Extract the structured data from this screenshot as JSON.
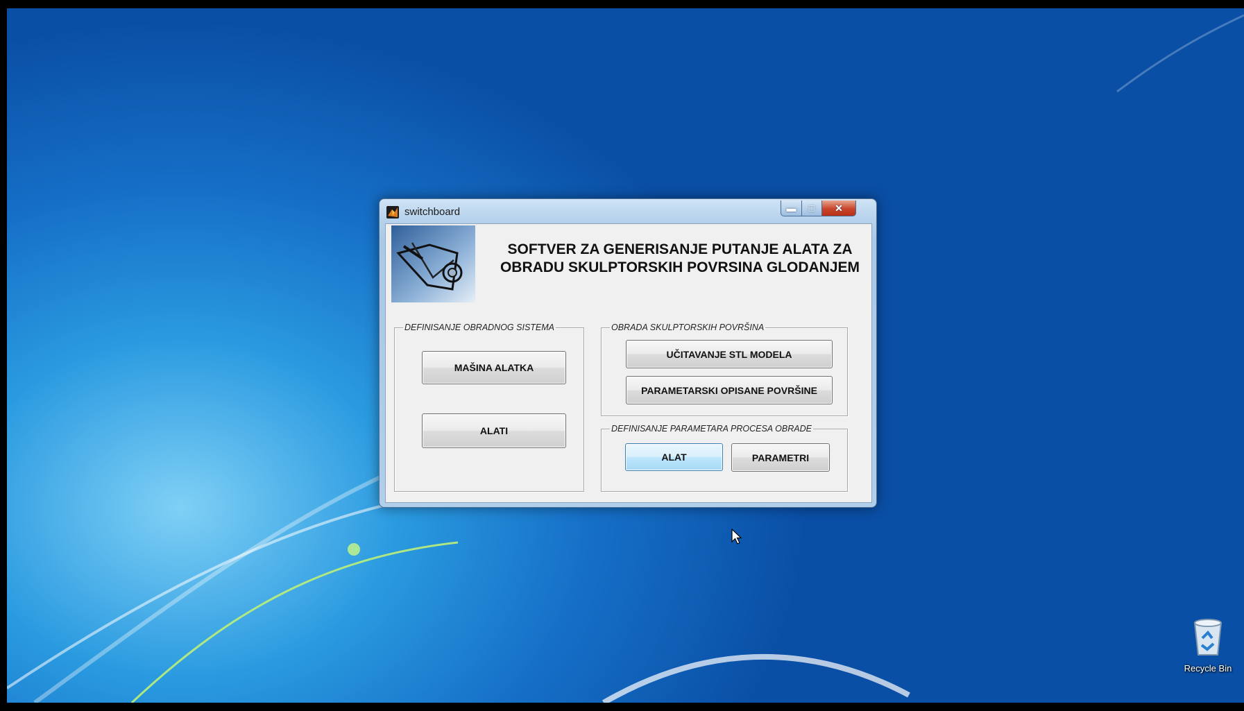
{
  "window": {
    "title": "switchboard",
    "heading_line1": "SOFTVER ZA GENERISANJE PUTANJE ALATA ZA",
    "heading_line2": "OBRADU SKULPTORSKIH POVRSINA GLODANJEM"
  },
  "groups": {
    "system": {
      "legend": "DEFINISANJE OBRADNOG SISTEMA",
      "masina_label": "MAŠINA ALATKA",
      "alati_label": "ALATI"
    },
    "surfaces": {
      "legend": "OBRADA SKULPTORSKIH POVRŠINA",
      "stl_label": "UČITAVANJE STL MODELA",
      "param_label": "PARAMETARSKI OPISANE POVRŠINE"
    },
    "process": {
      "legend": "DEFINISANJE PARAMETARA PROCESA OBRADE",
      "alat_label": "ALAT",
      "parametri_label": "PARAMETRI"
    }
  },
  "desktop": {
    "recycle_bin_label": "Recycle Bin"
  },
  "icons": {
    "app": "matlab-icon",
    "minimize": "minimize-icon",
    "maximize": "maximize-icon",
    "close": "close-icon",
    "cursor": "mouse-cursor-icon",
    "recycle_bin": "recycle-bin-icon"
  },
  "colors": {
    "desktop_blue": "#1670c7",
    "window_frame": "#b6d2ec",
    "close_red": "#c8452c",
    "focused_button": "#bee6fd"
  }
}
